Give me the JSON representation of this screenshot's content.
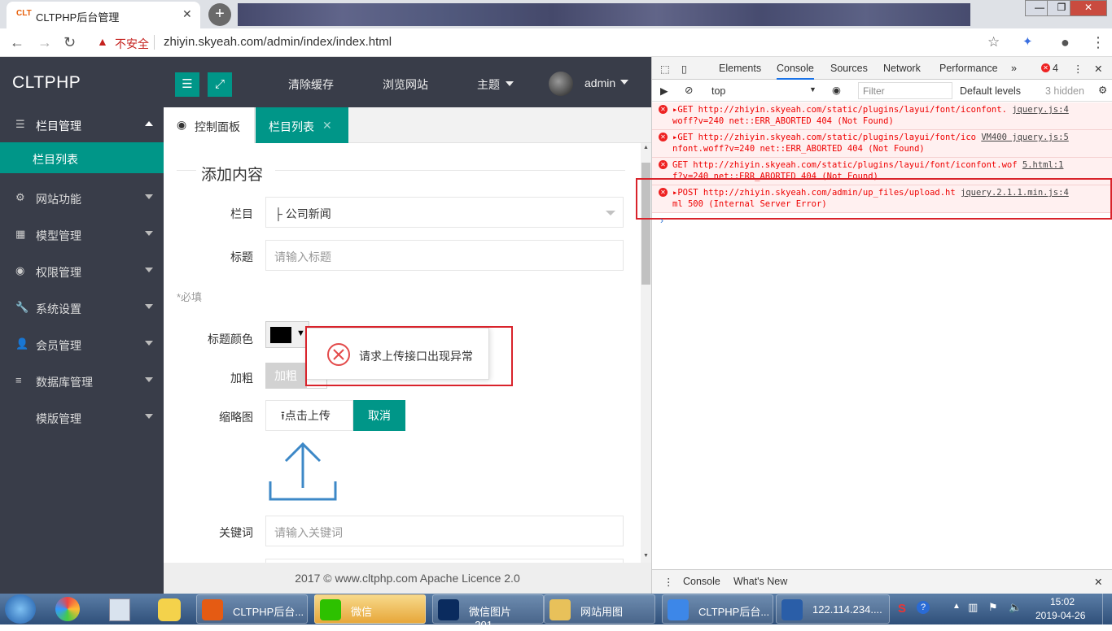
{
  "browser": {
    "tab_title": "CLTPHP后台管理",
    "tab_favicon": "CLT",
    "close_glyph": "✕",
    "new_tab_glyph": "+",
    "insecure_label": "不安全",
    "url": "zhiyin.skyeah.com/admin/index/index.html",
    "window_min": "—",
    "window_restore": "❐",
    "window_close": "✕"
  },
  "app": {
    "logo": "CLTPHP",
    "sidebar": [
      {
        "label": "栏目管理",
        "icon": "list-icon",
        "expanded": true
      },
      {
        "label": "网站功能",
        "icon": "gear-icon"
      },
      {
        "label": "模型管理",
        "icon": "model-icon"
      },
      {
        "label": "权限管理",
        "icon": "globe-icon"
      },
      {
        "label": "系统设置",
        "icon": "wrench-icon"
      },
      {
        "label": "会员管理",
        "icon": "user-icon"
      },
      {
        "label": "数据库管理",
        "icon": "database-icon"
      },
      {
        "label": "模版管理",
        "icon": "code-icon"
      }
    ],
    "sidebar_sub": "栏目列表",
    "header": {
      "clear_cache": "清除缓存",
      "browse_site": "浏览网站",
      "theme": "主题",
      "user": "admin"
    },
    "tabs": {
      "dashboard": "控制面板",
      "current": "栏目列表"
    },
    "form": {
      "section_title": "添加内容",
      "column_label": "栏目",
      "column_value": "├ 公司新闻",
      "title_label": "标题",
      "title_placeholder": "请输入标题",
      "required_note": "*必填",
      "title_color_label": "标题颜色",
      "bold_label": "加粗",
      "bold_btn": "加粗",
      "thumb_label": "缩略图",
      "upload_btn": "点击上传",
      "cancel_btn": "取消",
      "keywords_label": "关键词",
      "keywords_placeholder": "请输入关键词"
    },
    "dialog_message": "请求上传接口出现异常",
    "footer": "2017 ©  www.cltphp.com  Apache Licence 2.0"
  },
  "devtools": {
    "tabs": [
      "Elements",
      "Console",
      "Sources",
      "Network",
      "Performance"
    ],
    "more": "»",
    "error_count": "4",
    "context": "top",
    "filter_placeholder": "Filter",
    "levels": "Default levels",
    "hidden": "3 hidden",
    "logs": [
      {
        "line1": "▸GET http://zhiyin.skyeah.com/static/plugins/layui/font/iconfont.",
        "src1": "jquery.js:4",
        "line2": "woff?v=240 net::ERR_ABORTED 404 (Not Found)"
      },
      {
        "line1": "▸GET http://zhiyin.skyeah.com/static/plugins/layui/font/ico",
        "src1": "VM400 jquery.js:5",
        "line2": "nfont.woff?v=240 net::ERR_ABORTED 404 (Not Found)"
      },
      {
        "line1": "GET http://zhiyin.skyeah.com/static/plugins/layui/font/iconfont.wof",
        "src1": "5.html:1",
        "line2": "f?v=240 net::ERR_ABORTED 404 (Not Found)"
      },
      {
        "line1": "▸POST http://zhiyin.skyeah.com/admin/up_files/upload.ht",
        "src1": "jquery.2.1.1.min.js:4",
        "line2": "ml 500 (Internal Server Error)"
      }
    ],
    "prompt": "›",
    "drawer_tabs": [
      "Console",
      "What's New"
    ]
  },
  "taskbar": {
    "items": [
      {
        "label": "CLTPHP后台...",
        "color": "#e55b13"
      },
      {
        "label": "微信",
        "color": "#2dc100",
        "active": true
      },
      {
        "label": "微信图片_201...",
        "color": "#0a2b5e"
      },
      {
        "label": "网站用图",
        "color": "#e8c15a"
      },
      {
        "label": "CLTPHP后台...",
        "color": "#3d87e8"
      },
      {
        "label": "122.114.234....",
        "color": "#2a5ea8"
      }
    ],
    "time": "15:02",
    "date": "2019-04-26"
  },
  "colors": {
    "teal": "#009688",
    "dark": "#393d49",
    "error_red": "#d9232b"
  }
}
